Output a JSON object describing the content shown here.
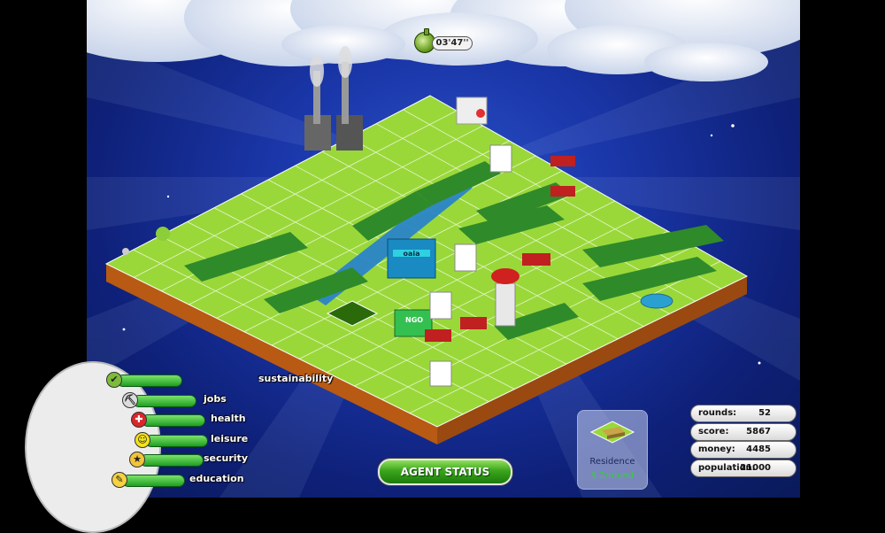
{
  "timer": {
    "value": "03'47''",
    "icon": "stopwatch-icon"
  },
  "meters": [
    {
      "key": "sustainability",
      "label": "sustainability",
      "icon": "check-icon",
      "level": 0.82,
      "color": "#7dbb3a"
    },
    {
      "key": "jobs",
      "label": "jobs",
      "icon": "pickaxe-icon",
      "level": 0.8,
      "color": "#dcdcdc"
    },
    {
      "key": "health",
      "label": "health",
      "icon": "red-cross-icon",
      "level": 0.8,
      "color": "#d8262a"
    },
    {
      "key": "leisure",
      "label": "leisure",
      "icon": "smiley-icon",
      "level": 0.78,
      "color": "#f4e21a"
    },
    {
      "key": "security",
      "label": "security",
      "icon": "star-icon",
      "level": 0.8,
      "color": "#f2c43a"
    },
    {
      "key": "education",
      "label": "education",
      "icon": "pencil-icon",
      "level": 0.78,
      "color": "#f4d240"
    }
  ],
  "agent_button": {
    "label": "AGENT STATUS"
  },
  "selected_building": {
    "name": "Residence",
    "cost": "$ 2/round",
    "icon": "residence-icon"
  },
  "stats": [
    {
      "key": "rounds",
      "label": "rounds:",
      "value": "52"
    },
    {
      "key": "score",
      "label": "score:",
      "value": "5867"
    },
    {
      "key": "money",
      "label": "money:",
      "value": "4485"
    },
    {
      "key": "population",
      "label": "population:",
      "value": "21000"
    }
  ],
  "board_signs": {
    "ngo": "NGO",
    "bank": "oaia"
  },
  "colors": {
    "grass": "#9ad83a",
    "forest": "#2f8a2a",
    "river": "#2a84c8",
    "soil": "#c86a1a",
    "sky": "#1a36a8"
  }
}
